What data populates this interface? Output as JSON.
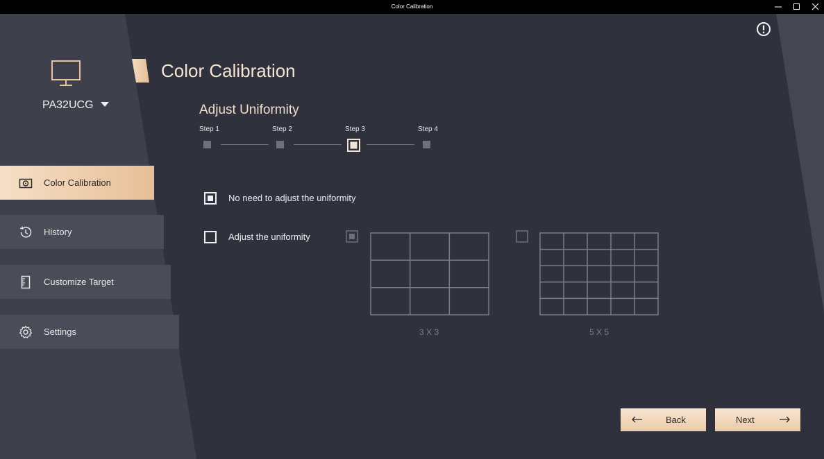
{
  "window": {
    "title": "Color Calibration"
  },
  "sidebar": {
    "device_name": "PA32UCG",
    "items": [
      {
        "label": "Color Calibration",
        "icon": "calibration-icon",
        "active": true
      },
      {
        "label": "History",
        "icon": "history-icon",
        "active": false
      },
      {
        "label": "Customize Target",
        "icon": "ruler-icon",
        "active": false
      },
      {
        "label": "Settings",
        "icon": "gear-icon",
        "active": false
      }
    ]
  },
  "main": {
    "title": "Color Calibration",
    "section_title": "Adjust Uniformity",
    "steps": [
      "Step 1",
      "Step 2",
      "Step 3",
      "Step 4"
    ],
    "current_step": 3,
    "options": [
      {
        "label": "No need to adjust the uniformity",
        "checked": true
      },
      {
        "label": "Adjust the uniformity",
        "checked": false
      }
    ],
    "grids": [
      {
        "caption": "3 X 3",
        "size": 3,
        "checked": true
      },
      {
        "caption": "5 X 5",
        "size": 5,
        "checked": false
      }
    ]
  },
  "footer": {
    "back_label": "Back",
    "next_label": "Next"
  },
  "colors": {
    "accent": "#e8c39e",
    "background": "#2f323d",
    "sidebar": "#3e414c"
  }
}
